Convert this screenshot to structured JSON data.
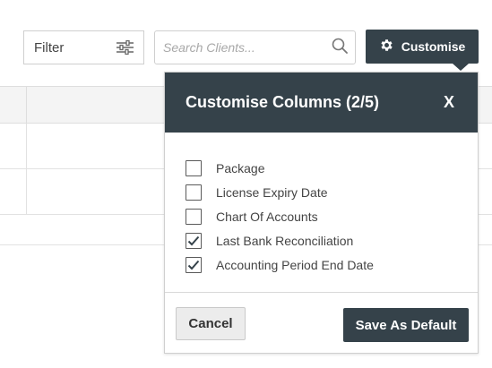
{
  "toolbar": {
    "filter_label": "Filter",
    "filter_icon": "sliders-icon",
    "search_placeholder": "Search Clients...",
    "search_value": "",
    "search_icon": "search-icon",
    "customise_label": "Customise",
    "customise_icon": "gear-icon"
  },
  "customise_panel": {
    "title": "Customise Columns (2/5)",
    "close_label": "X",
    "options": [
      {
        "label": "Package",
        "checked": false
      },
      {
        "label": "License Expiry Date",
        "checked": false
      },
      {
        "label": "Chart Of Accounts",
        "checked": false
      },
      {
        "label": "Last Bank Reconciliation",
        "checked": true
      },
      {
        "label": "Accounting Period End Date",
        "checked": true
      }
    ],
    "cancel_label": "Cancel",
    "save_label": "Save As Default"
  },
  "colors": {
    "dark_accent": "#35424a",
    "border": "#cfcfcf",
    "table_header_bg": "#f4f4f4"
  }
}
